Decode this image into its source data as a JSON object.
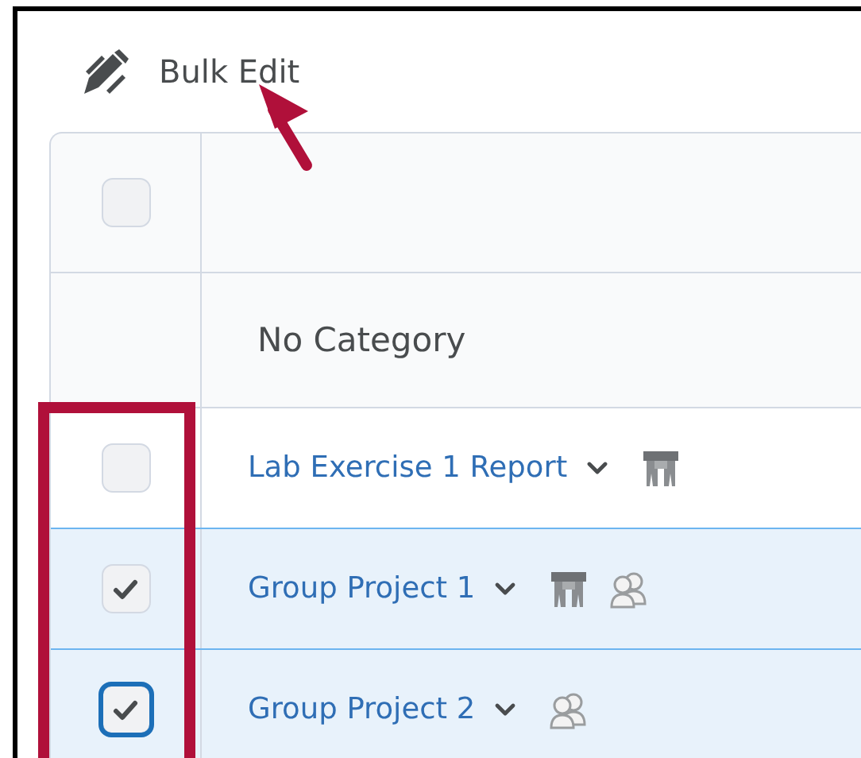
{
  "toolbar": {
    "bulk_edit": "Bulk Edit"
  },
  "table": {
    "header": {
      "select_all_checked": false
    },
    "category": "No Category",
    "rows": [
      {
        "title": "Lab Exercise 1 Report",
        "selected": false,
        "checked": false,
        "focused": false,
        "icons": [
          {
            "kind": "tool"
          }
        ]
      },
      {
        "title": "Group Project 1",
        "selected": true,
        "checked": true,
        "focused": false,
        "icons": [
          {
            "kind": "tool"
          },
          {
            "kind": "people"
          }
        ]
      },
      {
        "title": "Group Project 2",
        "selected": true,
        "checked": true,
        "focused": true,
        "icons": [
          {
            "kind": "people"
          }
        ]
      }
    ]
  }
}
